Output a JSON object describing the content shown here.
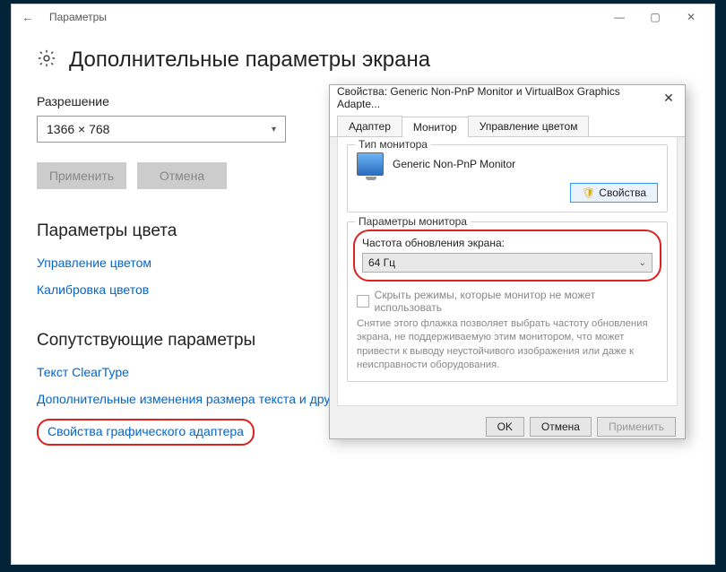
{
  "settings": {
    "window_title": "Параметры",
    "page_title": "Дополнительные параметры экрана",
    "resolution_label": "Разрешение",
    "resolution_value": "1366 × 768",
    "apply": "Применить",
    "cancel": "Отмена",
    "color_section": "Параметры цвета",
    "link_color_mgmt": "Управление цветом",
    "link_calibration": "Калибровка цветов",
    "related_section": "Сопутствующие параметры",
    "link_cleartype": "Текст ClearType",
    "link_textsize": "Дополнительные изменения размера текста и других элементов",
    "link_adapter": "Свойства графического адаптера"
  },
  "dialog": {
    "title": "Свойства: Generic Non-PnP Monitor и VirtualBox Graphics Adapte...",
    "tabs": {
      "adapter": "Адаптер",
      "monitor": "Монитор",
      "color": "Управление цветом"
    },
    "group_type": "Тип монитора",
    "monitor_name": "Generic Non-PnP Monitor",
    "properties_btn": "Свойства",
    "group_params": "Параметры монитора",
    "refresh_label": "Частота обновления экрана:",
    "refresh_value": "64 Гц",
    "hide_modes": "Скрыть режимы, которые монитор не может использовать",
    "hint": "Снятие этого флажка позволяет выбрать частоту обновления экрана, не поддерживаемую этим монитором, что может привести к выводу неустойчивого изображения или даже к неисправности оборудования.",
    "ok": "OK",
    "cancel": "Отмена",
    "apply": "Применить"
  }
}
